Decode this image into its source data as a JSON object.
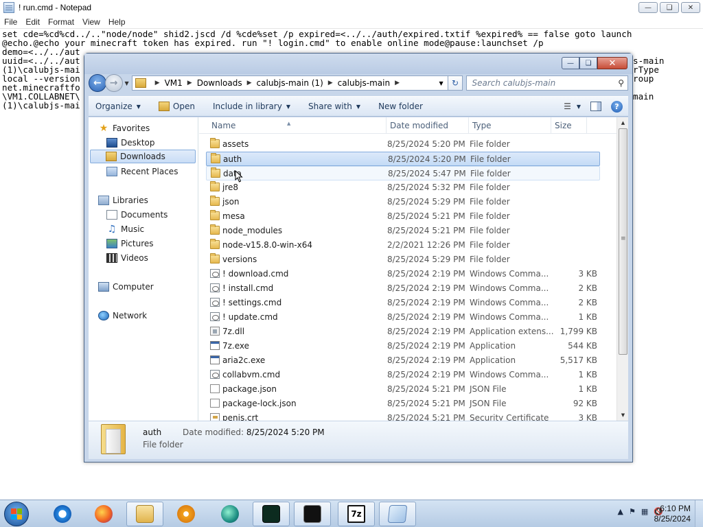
{
  "notepad": {
    "title": "! run.cmd - Notepad",
    "menu": [
      "File",
      "Edit",
      "Format",
      "View",
      "Help"
    ],
    "lines": [
      "set cde=%cd%cd../..\"node/node\" shid2.jscd /d %cde%set /p expired=<../../auth/expired.txtif %expired% == false goto launch",
      "@echo.@echo your minecraft token has expired. run \"! login.cmd\" to enable online mode@pause:launchset /p",
      "demo=<../../aut",
      "uuid=<../../aut",
      "(1)\\calubjs-mai",
      "local --version",
      "net.minecraftfo",
      "\\VM1.COLLABNET\\",
      "(1)\\calubjs-mai"
    ],
    "right_fragments": [
      "s-main",
      "rType",
      "roup",
      "",
      "main"
    ]
  },
  "explorer": {
    "address": [
      "VM1",
      "Downloads",
      "calubjs-main (1)",
      "calubjs-main"
    ],
    "search_placeholder": "Search calubjs-main",
    "toolbar": {
      "organize": "Organize",
      "open": "Open",
      "include": "Include in library",
      "share": "Share with",
      "new_folder": "New folder"
    },
    "nav": {
      "favorites": "Favorites",
      "desktop": "Desktop",
      "downloads": "Downloads",
      "recent": "Recent Places",
      "libraries": "Libraries",
      "documents": "Documents",
      "music": "Music",
      "pictures": "Pictures",
      "videos": "Videos",
      "computer": "Computer",
      "network": "Network"
    },
    "columns": {
      "name": "Name",
      "date": "Date modified",
      "type": "Type",
      "size": "Size"
    },
    "files": [
      {
        "name": "assets",
        "date": "8/25/2024 5:20 PM",
        "type": "File folder",
        "size": "",
        "icon": "folder"
      },
      {
        "name": "auth",
        "date": "8/25/2024 5:20 PM",
        "type": "File folder",
        "size": "",
        "icon": "folder"
      },
      {
        "name": "data",
        "date": "8/25/2024 5:47 PM",
        "type": "File folder",
        "size": "",
        "icon": "folder"
      },
      {
        "name": "jre8",
        "date": "8/25/2024 5:32 PM",
        "type": "File folder",
        "size": "",
        "icon": "folder"
      },
      {
        "name": "json",
        "date": "8/25/2024 5:29 PM",
        "type": "File folder",
        "size": "",
        "icon": "folder"
      },
      {
        "name": "mesa",
        "date": "8/25/2024 5:21 PM",
        "type": "File folder",
        "size": "",
        "icon": "folder"
      },
      {
        "name": "node_modules",
        "date": "8/25/2024 5:21 PM",
        "type": "File folder",
        "size": "",
        "icon": "folder"
      },
      {
        "name": "node-v15.8.0-win-x64",
        "date": "2/2/2021 12:26 PM",
        "type": "File folder",
        "size": "",
        "icon": "folder"
      },
      {
        "name": "versions",
        "date": "8/25/2024 5:29 PM",
        "type": "File folder",
        "size": "",
        "icon": "folder"
      },
      {
        "name": "! download.cmd",
        "date": "8/25/2024 2:19 PM",
        "type": "Windows Comma...",
        "size": "3 KB",
        "icon": "cmd"
      },
      {
        "name": "! install.cmd",
        "date": "8/25/2024 2:19 PM",
        "type": "Windows Comma...",
        "size": "2 KB",
        "icon": "cmd"
      },
      {
        "name": "! settings.cmd",
        "date": "8/25/2024 2:19 PM",
        "type": "Windows Comma...",
        "size": "2 KB",
        "icon": "cmd"
      },
      {
        "name": "! update.cmd",
        "date": "8/25/2024 2:19 PM",
        "type": "Windows Comma...",
        "size": "1 KB",
        "icon": "cmd"
      },
      {
        "name": "7z.dll",
        "date": "8/25/2024 2:19 PM",
        "type": "Application extens...",
        "size": "1,799 KB",
        "icon": "dll"
      },
      {
        "name": "7z.exe",
        "date": "8/25/2024 2:19 PM",
        "type": "Application",
        "size": "544 KB",
        "icon": "exe"
      },
      {
        "name": "aria2c.exe",
        "date": "8/25/2024 2:19 PM",
        "type": "Application",
        "size": "5,517 KB",
        "icon": "exe"
      },
      {
        "name": "collabvm.cmd",
        "date": "8/25/2024 2:19 PM",
        "type": "Windows Comma...",
        "size": "1 KB",
        "icon": "cmd"
      },
      {
        "name": "package.json",
        "date": "8/25/2024 5:21 PM",
        "type": "JSON File",
        "size": "1 KB",
        "icon": "json"
      },
      {
        "name": "package-lock.json",
        "date": "8/25/2024 5:21 PM",
        "type": "JSON File",
        "size": "92 KB",
        "icon": "json"
      },
      {
        "name": "penis.crt",
        "date": "8/25/2024 5:21 PM",
        "type": "Security Certificate",
        "size": "3 KB",
        "icon": "crt"
      }
    ],
    "selected_index": 1,
    "hover_index": 2,
    "details": {
      "name": "auth",
      "type": "File folder",
      "modified_label": "Date modified:",
      "modified_value": "8/25/2024 5:20 PM"
    }
  },
  "taskbar": {
    "time": "6:10 PM",
    "date": "8/25/2024",
    "apps": [
      "internet-explorer-icon",
      "firefox-icon",
      "explorer-icon",
      "media-player-icon",
      "app-icon",
      "terminal-icon",
      "cmd-icon",
      "7zip-icon",
      "notepad-icon"
    ]
  },
  "colors": {
    "window_frame": "#c7d6ea",
    "selection": "#c4dbf6",
    "taskbar": "#b5cbe4"
  }
}
